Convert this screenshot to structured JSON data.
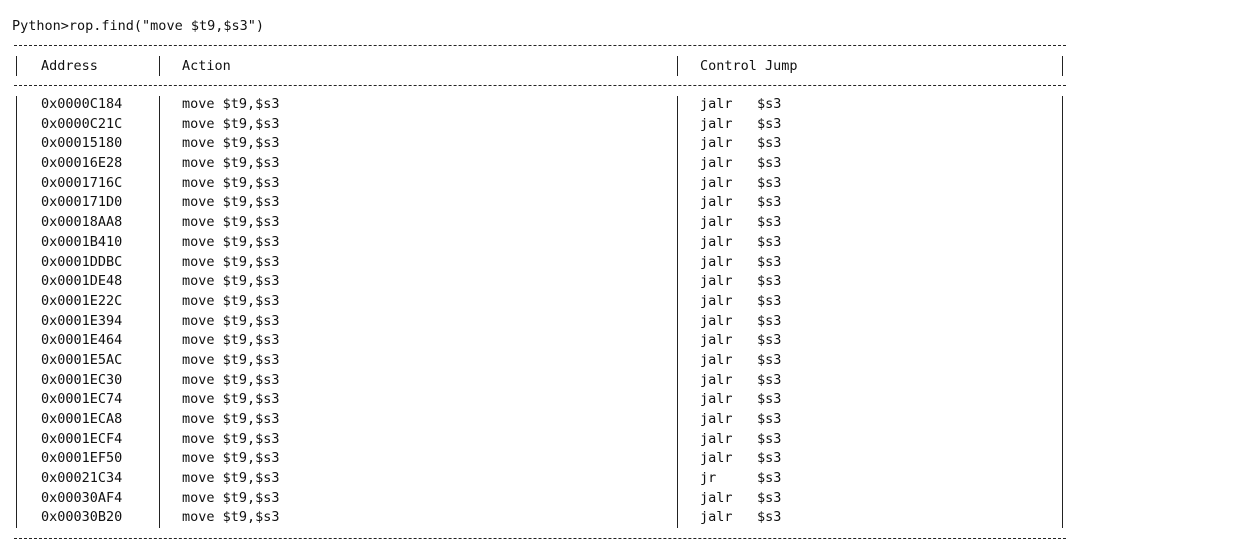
{
  "console": {
    "prompt": "Python>",
    "command": "rop.find(\"move $t9,$s3\")"
  },
  "table": {
    "headers": {
      "address": "Address",
      "action": "Action",
      "control_jump": "Control Jump"
    },
    "rows": [
      {
        "address": "0x0000C184",
        "action": "move $t9,$s3",
        "jump_instr": "jalr",
        "jump_reg": "$s3"
      },
      {
        "address": "0x0000C21C",
        "action": "move $t9,$s3",
        "jump_instr": "jalr",
        "jump_reg": "$s3"
      },
      {
        "address": "0x00015180",
        "action": "move $t9,$s3",
        "jump_instr": "jalr",
        "jump_reg": "$s3"
      },
      {
        "address": "0x00016E28",
        "action": "move $t9,$s3",
        "jump_instr": "jalr",
        "jump_reg": "$s3"
      },
      {
        "address": "0x0001716C",
        "action": "move $t9,$s3",
        "jump_instr": "jalr",
        "jump_reg": "$s3"
      },
      {
        "address": "0x000171D0",
        "action": "move $t9,$s3",
        "jump_instr": "jalr",
        "jump_reg": "$s3"
      },
      {
        "address": "0x00018AA8",
        "action": "move $t9,$s3",
        "jump_instr": "jalr",
        "jump_reg": "$s3"
      },
      {
        "address": "0x0001B410",
        "action": "move $t9,$s3",
        "jump_instr": "jalr",
        "jump_reg": "$s3"
      },
      {
        "address": "0x0001DDBC",
        "action": "move $t9,$s3",
        "jump_instr": "jalr",
        "jump_reg": "$s3"
      },
      {
        "address": "0x0001DE48",
        "action": "move $t9,$s3",
        "jump_instr": "jalr",
        "jump_reg": "$s3"
      },
      {
        "address": "0x0001E22C",
        "action": "move $t9,$s3",
        "jump_instr": "jalr",
        "jump_reg": "$s3"
      },
      {
        "address": "0x0001E394",
        "action": "move $t9,$s3",
        "jump_instr": "jalr",
        "jump_reg": "$s3"
      },
      {
        "address": "0x0001E464",
        "action": "move $t9,$s3",
        "jump_instr": "jalr",
        "jump_reg": "$s3"
      },
      {
        "address": "0x0001E5AC",
        "action": "move $t9,$s3",
        "jump_instr": "jalr",
        "jump_reg": "$s3"
      },
      {
        "address": "0x0001EC30",
        "action": "move $t9,$s3",
        "jump_instr": "jalr",
        "jump_reg": "$s3"
      },
      {
        "address": "0x0001EC74",
        "action": "move $t9,$s3",
        "jump_instr": "jalr",
        "jump_reg": "$s3"
      },
      {
        "address": "0x0001ECA8",
        "action": "move $t9,$s3",
        "jump_instr": "jalr",
        "jump_reg": "$s3"
      },
      {
        "address": "0x0001ECF4",
        "action": "move $t9,$s3",
        "jump_instr": "jalr",
        "jump_reg": "$s3"
      },
      {
        "address": "0x0001EF50",
        "action": "move $t9,$s3",
        "jump_instr": "jalr",
        "jump_reg": "$s3"
      },
      {
        "address": "0x00021C34",
        "action": "move $t9,$s3",
        "jump_instr": "jr",
        "jump_reg": "$s3"
      },
      {
        "address": "0x00030AF4",
        "action": "move $t9,$s3",
        "jump_instr": "jalr",
        "jump_reg": "$s3"
      },
      {
        "address": "0x00030B20",
        "action": "move $t9,$s3",
        "jump_instr": "jalr",
        "jump_reg": "$s3"
      }
    ]
  }
}
